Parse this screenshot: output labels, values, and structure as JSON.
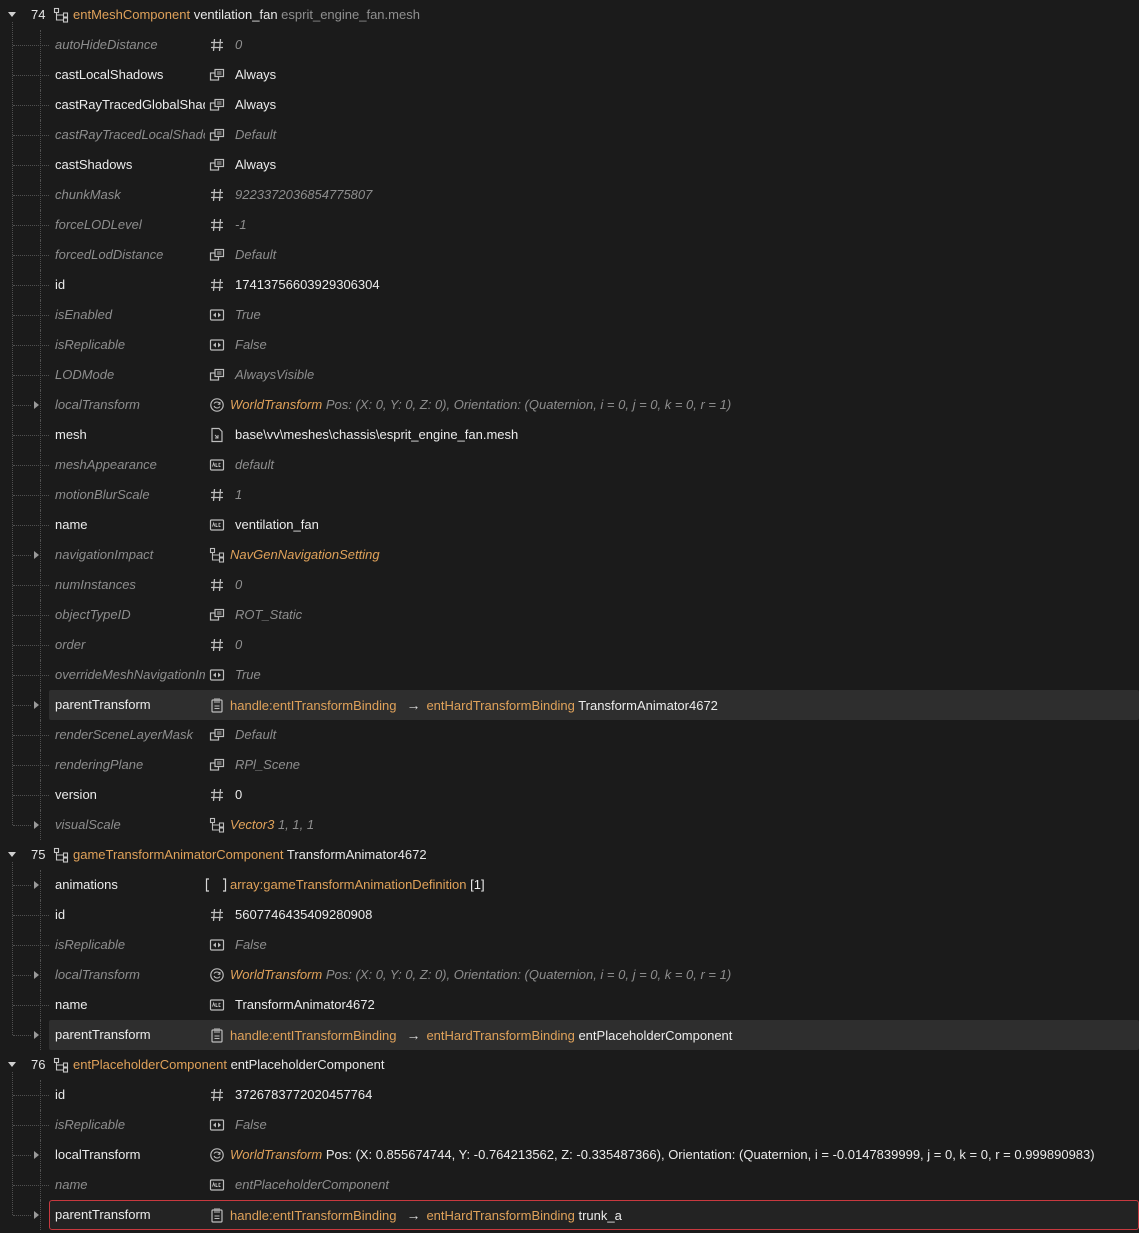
{
  "colors": {
    "background": "#1b1b1b",
    "type_accent": "#e0a25a",
    "default_text": "#8e8e8e",
    "set_text": "#ececec",
    "error_border": "#c8393f",
    "highlight": "#2e2e2e"
  },
  "rows": [
    {
      "kind": "component",
      "index": "74",
      "type": "entMeshComponent",
      "name": "ventilation_fan",
      "file": "esprit_engine_fan.mesh",
      "icon": "component-icon"
    },
    {
      "kind": "prop",
      "name": "autoHideDistance",
      "icon": "hash-icon",
      "value": "0",
      "state": "default"
    },
    {
      "kind": "prop",
      "name": "castLocalShadows",
      "icon": "enum-icon",
      "value": "Always",
      "state": "set"
    },
    {
      "kind": "prop",
      "name": "castRayTracedGlobalShadows",
      "icon": "enum-icon",
      "value": "Always",
      "state": "set"
    },
    {
      "kind": "prop",
      "name": "castRayTracedLocalShadows",
      "icon": "enum-icon",
      "value": "Default",
      "state": "default"
    },
    {
      "kind": "prop",
      "name": "castShadows",
      "icon": "enum-icon",
      "value": "Always",
      "state": "set"
    },
    {
      "kind": "prop",
      "name": "chunkMask",
      "icon": "hash-icon",
      "value": "9223372036854775807",
      "state": "default"
    },
    {
      "kind": "prop",
      "name": "forceLODLevel",
      "icon": "hash-icon",
      "value": "-1",
      "state": "default"
    },
    {
      "kind": "prop",
      "name": "forcedLodDistance",
      "icon": "enum-icon",
      "value": "Default",
      "state": "default"
    },
    {
      "kind": "prop",
      "name": "id",
      "icon": "hash-icon",
      "value": "17413756603929306304",
      "state": "set"
    },
    {
      "kind": "prop",
      "name": "isEnabled",
      "icon": "bool-icon",
      "value": "True",
      "state": "default"
    },
    {
      "kind": "prop",
      "name": "isReplicable",
      "icon": "bool-icon",
      "value": "False",
      "state": "default"
    },
    {
      "kind": "prop",
      "name": "LODMode",
      "icon": "enum-icon",
      "value": "AlwaysVisible",
      "state": "default"
    },
    {
      "kind": "prop",
      "name": "localTransform",
      "icon": "transform-icon",
      "type": "WorldTransform",
      "value": "Pos: (X: 0, Y: 0, Z: 0), Orientation: (Quaternion, i = 0, j = 0, k = 0, r = 1)",
      "state": "default",
      "expandable": true
    },
    {
      "kind": "prop",
      "name": "mesh",
      "icon": "file-icon",
      "value": "base\\vv\\meshes\\chassis\\esprit_engine_fan.mesh",
      "state": "set"
    },
    {
      "kind": "prop",
      "name": "meshAppearance",
      "icon": "string-icon",
      "value": "default",
      "state": "default"
    },
    {
      "kind": "prop",
      "name": "motionBlurScale",
      "icon": "hash-icon",
      "value": "1",
      "state": "default"
    },
    {
      "kind": "prop",
      "name": "name",
      "icon": "string-icon",
      "value": "ventilation_fan",
      "state": "set"
    },
    {
      "kind": "prop",
      "name": "navigationImpact",
      "icon": "struct-icon",
      "type": "NavGenNavigationSetting",
      "value": "",
      "state": "default",
      "expandable": true
    },
    {
      "kind": "prop",
      "name": "numInstances",
      "icon": "hash-icon",
      "value": "0",
      "state": "default"
    },
    {
      "kind": "prop",
      "name": "objectTypeID",
      "icon": "enum-icon",
      "value": "ROT_Static",
      "state": "default"
    },
    {
      "kind": "prop",
      "name": "order",
      "icon": "hash-icon",
      "value": "0",
      "state": "default"
    },
    {
      "kind": "prop",
      "name": "overrideMeshNavigationImpact",
      "icon": "bool-icon",
      "value": "True",
      "state": "default"
    },
    {
      "kind": "prop",
      "name": "parentTransform",
      "icon": "handle-icon",
      "handle": "handle:entITransformBinding",
      "target": "entHardTransformBinding",
      "value": "TransformAnimator4672",
      "state": "set",
      "expandable": true,
      "highlight": "hl"
    },
    {
      "kind": "prop",
      "name": "renderSceneLayerMask",
      "icon": "enum-icon",
      "value": "Default",
      "state": "default"
    },
    {
      "kind": "prop",
      "name": "renderingPlane",
      "icon": "enum-icon",
      "value": "RPl_Scene",
      "state": "default"
    },
    {
      "kind": "prop",
      "name": "version",
      "icon": "hash-icon",
      "value": "0",
      "state": "set"
    },
    {
      "kind": "prop",
      "name": "visualScale",
      "icon": "struct-icon",
      "type": "Vector3",
      "value": "1, 1, 1",
      "state": "default",
      "expandable": true
    },
    {
      "kind": "component",
      "index": "75",
      "type": "gameTransformAnimatorComponent",
      "name": "TransformAnimator4672",
      "file": "",
      "icon": "component-icon"
    },
    {
      "kind": "prop",
      "name": "animations",
      "icon": "array-icon",
      "array_type": "array:gameTransformAnimationDefinition",
      "value": "[1]",
      "state": "set",
      "expandable": true
    },
    {
      "kind": "prop",
      "name": "id",
      "icon": "hash-icon",
      "value": "5607746435409280908",
      "state": "set"
    },
    {
      "kind": "prop",
      "name": "isReplicable",
      "icon": "bool-icon",
      "value": "False",
      "state": "default"
    },
    {
      "kind": "prop",
      "name": "localTransform",
      "icon": "transform-icon",
      "type": "WorldTransform",
      "value": "Pos: (X: 0, Y: 0, Z: 0), Orientation: (Quaternion, i = 0, j = 0, k = 0, r = 1)",
      "state": "default",
      "expandable": true
    },
    {
      "kind": "prop",
      "name": "name",
      "icon": "string-icon",
      "value": "TransformAnimator4672",
      "state": "set"
    },
    {
      "kind": "prop",
      "name": "parentTransform",
      "icon": "handle-icon",
      "handle": "handle:entITransformBinding",
      "target": "entHardTransformBinding",
      "value": "entPlaceholderComponent",
      "state": "set",
      "expandable": true,
      "highlight": "hl"
    },
    {
      "kind": "component",
      "index": "76",
      "type": "entPlaceholderComponent",
      "name": "entPlaceholderComponent",
      "file": "",
      "icon": "component-icon"
    },
    {
      "kind": "prop",
      "name": "id",
      "icon": "hash-icon",
      "value": "3726783772020457764",
      "state": "set"
    },
    {
      "kind": "prop",
      "name": "isReplicable",
      "icon": "bool-icon",
      "value": "False",
      "state": "default"
    },
    {
      "kind": "prop",
      "name": "localTransform",
      "icon": "transform-icon",
      "type": "WorldTransform",
      "value": "Pos: (X: 0.855674744, Y: -0.764213562, Z: -0.335487366), Orientation: (Quaternion, i = -0.0147839999, j = 0, k = 0, r = 0.999890983)",
      "state": "set",
      "expandable": true
    },
    {
      "kind": "prop",
      "name": "name",
      "icon": "string-icon",
      "value": "entPlaceholderComponent",
      "state": "default"
    },
    {
      "kind": "prop",
      "name": "parentTransform",
      "icon": "handle-icon",
      "handle": "handle:entITransformBinding",
      "target": "entHardTransformBinding",
      "value": "trunk_a",
      "state": "set",
      "expandable": true,
      "highlight": "err"
    }
  ]
}
